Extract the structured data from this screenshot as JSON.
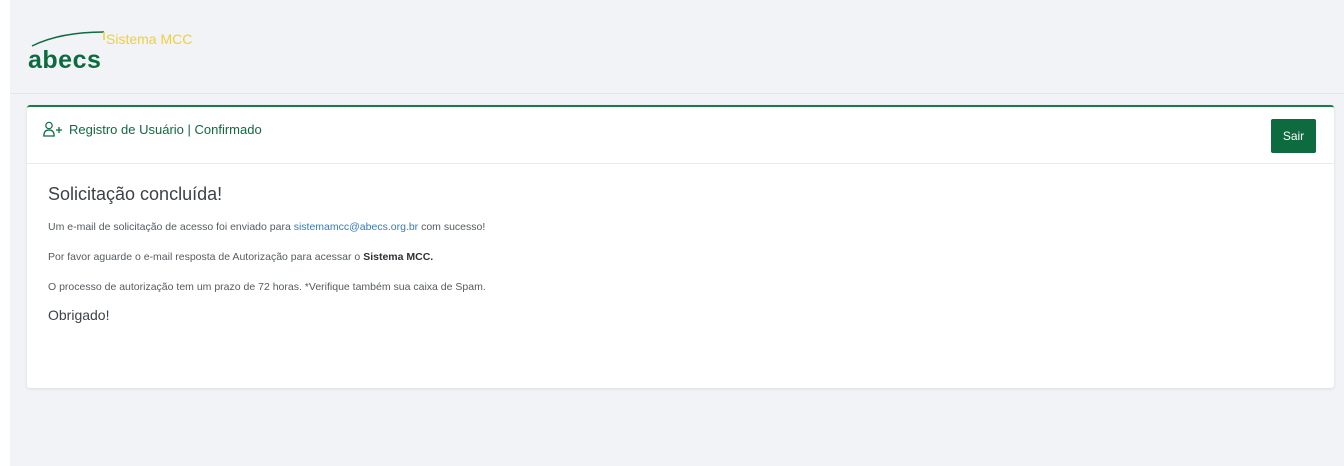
{
  "app": {
    "logo_text": "abecs",
    "system_name": "Sistema MCC"
  },
  "card": {
    "title": "Registro de Usuário | Confirmado",
    "logout_label": "Sair"
  },
  "message": {
    "heading": "Solicitação concluída!",
    "line1_prefix": "Um e-mail de solicitação de acesso foi enviado para ",
    "line1_email": "sistemamcc@abecs.org.br",
    "line1_suffix": " com sucesso!",
    "line2_prefix": "Por favor aguarde o e-mail resposta de Autorização para acessar o ",
    "line2_bold": "Sistema MCC.",
    "line3": "O processo de autorização tem um prazo de 72 horas. *Verifique também sua caixa de Spam.",
    "thanks": "Obrigado!"
  },
  "colors": {
    "brand_green": "#0d6b3f",
    "logo_yellow": "#f0cf3c",
    "link_blue": "#2f7dc1"
  }
}
